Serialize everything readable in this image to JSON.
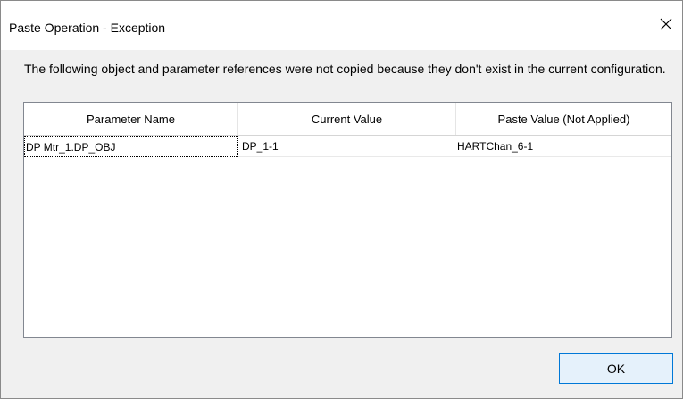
{
  "window": {
    "title": "Paste Operation - Exception",
    "close_glyph": "✕"
  },
  "message": "The following object and parameter references were not copied because they don't exist in the current configuration.",
  "table": {
    "columns": [
      "Parameter Name",
      "Current Value",
      "Paste Value (Not Applied)"
    ],
    "rows": [
      [
        "DP Mtr_1.DP_OBJ",
        "DP_1-1",
        "HARTChan_6-1"
      ]
    ]
  },
  "buttons": {
    "ok_label": "OK"
  },
  "colors": {
    "accent": "#0078d7",
    "button_bg": "#e5f1fb",
    "dialog_bg": "#f0f0f0"
  }
}
